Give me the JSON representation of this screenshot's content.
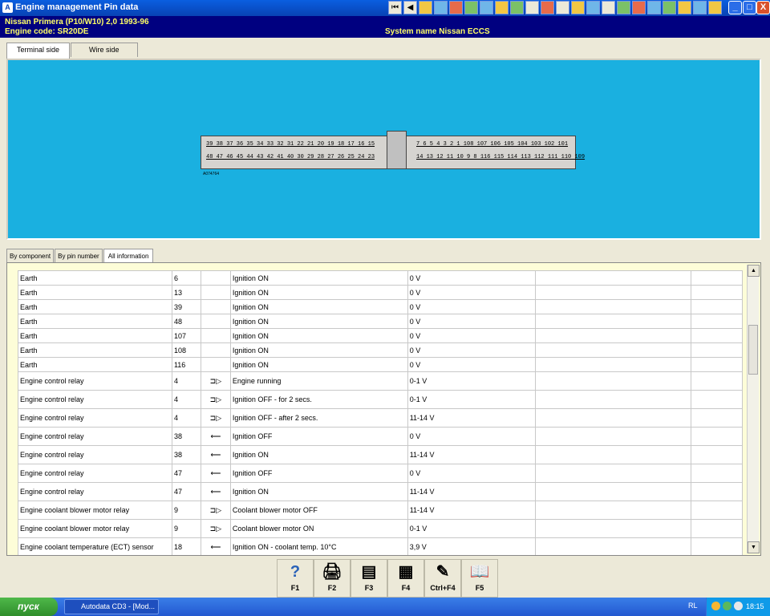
{
  "window": {
    "title": "Engine management Pin data",
    "toolbar_icons": [
      "first-icon",
      "prev-icon",
      "warning-icon",
      "doc-icon",
      "chart-icon",
      "module-icon",
      "pin-icon",
      "gauge-icon",
      "table-icon",
      "print-icon",
      "report-icon",
      "tools-icon",
      "check-icon",
      "car-icon",
      "blank-icon",
      "camera-icon",
      "diagram-icon",
      "engine-icon",
      "globe-icon",
      "alert-icon",
      "settings-icon",
      "info-icon"
    ],
    "min_label": "_",
    "max_label": "□",
    "close_label": "X"
  },
  "info": {
    "vehicle": "Nissan   Primera (P10/W10) 2,0  1993-96",
    "engine": "Engine code: SR20DE",
    "system": "System name Nissan ECCS"
  },
  "top_tabs": [
    "Terminal side",
    "Wire side"
  ],
  "connector": {
    "row1_left": "39 38 37 36 35 34 33 32 31   22 21 20 19 18 17 16 15",
    "row2_left": "48 47 46 45 44 43 42 41 40   30 29 28 27 26 25 24 23",
    "row1_right": "7  6  5  4  3  2  1    108 107 106 105 104 103 102 101",
    "row2_right": "14 13 12 11 10  9  8    116 115 114 113 112 111 110 109",
    "code": "A074764"
  },
  "lower_tabs": [
    "By component",
    "By pin number",
    "All information"
  ],
  "rows": [
    {
      "component": "Earth",
      "pin": "6",
      "arrow": "",
      "condition": "Ignition ON",
      "value": "0 V"
    },
    {
      "component": "Earth",
      "pin": "13",
      "arrow": "",
      "condition": "Ignition ON",
      "value": "0 V"
    },
    {
      "component": "Earth",
      "pin": "39",
      "arrow": "",
      "condition": "Ignition ON",
      "value": "0 V"
    },
    {
      "component": "Earth",
      "pin": "48",
      "arrow": "",
      "condition": "Ignition ON",
      "value": "0 V"
    },
    {
      "component": "Earth",
      "pin": "107",
      "arrow": "",
      "condition": "Ignition ON",
      "value": "0 V"
    },
    {
      "component": "Earth",
      "pin": "108",
      "arrow": "",
      "condition": "Ignition ON",
      "value": "0 V"
    },
    {
      "component": "Earth",
      "pin": "116",
      "arrow": "",
      "condition": "Ignition ON",
      "value": "0 V"
    },
    {
      "component": "Engine control relay",
      "pin": "4",
      "arrow": "⊐▷",
      "condition": "Engine running",
      "value": "0-1 V"
    },
    {
      "component": "Engine control relay",
      "pin": "4",
      "arrow": "⊐▷",
      "condition": "Ignition OFF - for 2 secs.",
      "value": "0-1 V"
    },
    {
      "component": "Engine control relay",
      "pin": "4",
      "arrow": "⊐▷",
      "condition": "Ignition OFF - after 2 secs.",
      "value": "11-14 V"
    },
    {
      "component": "Engine control relay",
      "pin": "38",
      "arrow": "⟵",
      "condition": "Ignition OFF",
      "value": "0 V"
    },
    {
      "component": "Engine control relay",
      "pin": "38",
      "arrow": "⟵",
      "condition": "Ignition ON",
      "value": "11-14 V"
    },
    {
      "component": "Engine control relay",
      "pin": "47",
      "arrow": "⟵",
      "condition": "Ignition OFF",
      "value": "0 V"
    },
    {
      "component": "Engine control relay",
      "pin": "47",
      "arrow": "⟵",
      "condition": "Ignition ON",
      "value": "11-14 V"
    },
    {
      "component": "Engine coolant blower motor relay",
      "pin": "9",
      "arrow": "⊐▷",
      "condition": "Coolant blower motor OFF",
      "value": "11-14 V"
    },
    {
      "component": "Engine coolant blower motor relay",
      "pin": "9",
      "arrow": "⊐▷",
      "condition": "Coolant blower motor ON",
      "value": "0-1 V"
    },
    {
      "component": "Engine coolant temperature (ECT) sensor",
      "pin": "18",
      "arrow": "⟵",
      "condition": "Ignition ON - coolant temp. 10°C",
      "value": "3,9 V"
    }
  ],
  "fkeys": [
    {
      "icon": "help-icon",
      "glyph": "?",
      "label": "F1"
    },
    {
      "icon": "print-icon",
      "glyph": "🖨",
      "label": "F2"
    },
    {
      "icon": "copy-icon",
      "glyph": "▤",
      "label": "F3"
    },
    {
      "icon": "export-icon",
      "glyph": "▦",
      "label": "F4"
    },
    {
      "icon": "note-icon",
      "glyph": "✎",
      "label": "Ctrl+F4"
    },
    {
      "icon": "book-icon",
      "glyph": "📖",
      "label": "F5"
    }
  ],
  "taskbar": {
    "start_label": "пуск",
    "task_label": "Autodata CD3 - [Mod...",
    "lang": "RL",
    "time": "18:15"
  }
}
